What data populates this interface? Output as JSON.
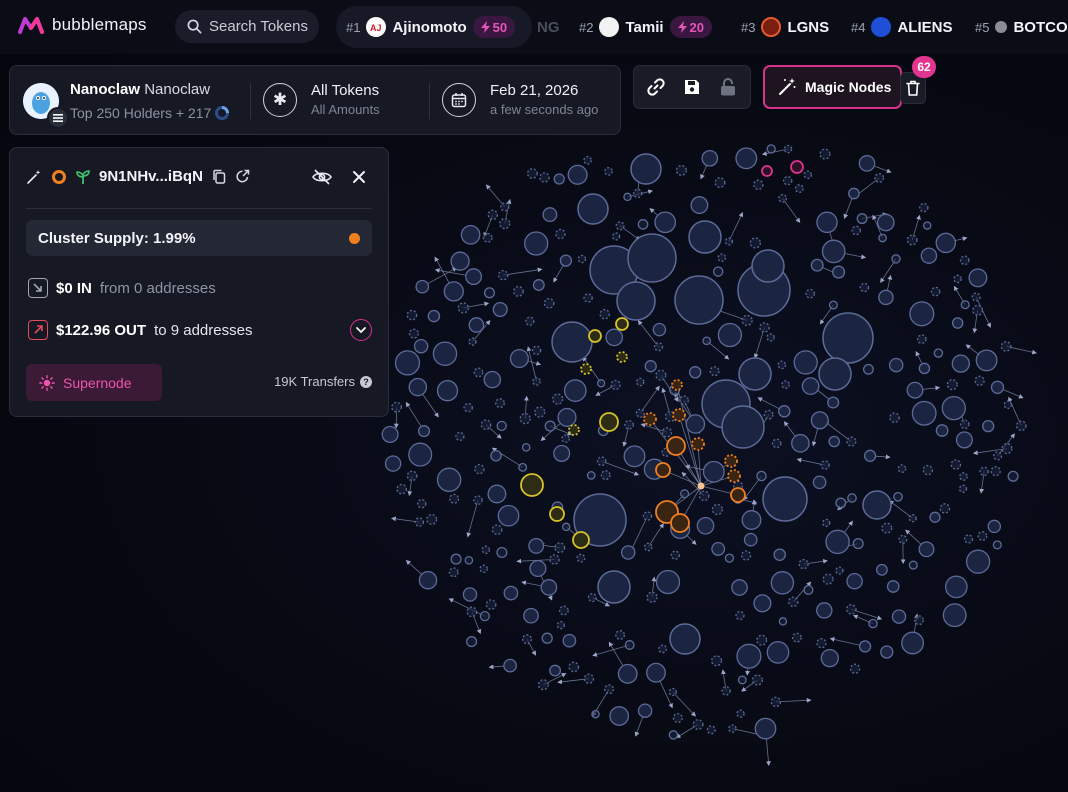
{
  "brand": {
    "name": "bubblemaps"
  },
  "search": {
    "placeholder": "Search Tokens"
  },
  "trending": [
    {
      "rank": "#1",
      "name": "Ajinomoto",
      "boost": "50"
    },
    {
      "rank": "",
      "name": "NG"
    },
    {
      "rank": "#2",
      "name": "Tamii",
      "boost": "20"
    },
    {
      "rank": "#3",
      "name": "LGNS"
    },
    {
      "rank": "#4",
      "name": "ALIENS"
    },
    {
      "rank": "#5",
      "name": "BOTCO"
    }
  ],
  "token": {
    "name": "Nanoclaw",
    "symbol": "Nanoclaw",
    "subtitle": "Top 250 Holders + 217",
    "filter_main": "All Tokens",
    "filter_sub": "All Amounts",
    "date_main": "Feb 21, 2026",
    "date_sub": "a few seconds ago"
  },
  "toolbar": {
    "magic_label": "Magic Nodes",
    "badge_count": "62"
  },
  "cluster": {
    "address": "9N1NHv...iBqN",
    "supply_label": "Cluster Supply: 1.99%",
    "in_amount": "$0 IN",
    "in_desc": "from 0 addresses",
    "out_amount": "$122.96 OUT",
    "out_desc": "to 9 addresses",
    "supernode_label": "Supernode",
    "transfers": "19K Transfers"
  },
  "colors": {
    "accent": "#d9318f",
    "cluster_orange": "#f07f1f",
    "cluster_yellow": "#d7c227",
    "node_fill": "#1b2440",
    "node_stroke": "#5c6b98"
  },
  "icons": [
    "search-icon",
    "link-icon",
    "save-icon",
    "lock-icon",
    "magic-wand-icon",
    "trash-icon",
    "copy-icon",
    "external-link-icon",
    "hide-icon",
    "close-icon",
    "calendar-icon",
    "asterisk-icon",
    "chevron-down-icon",
    "sun-icon",
    "sprout-icon",
    "help-icon"
  ]
}
